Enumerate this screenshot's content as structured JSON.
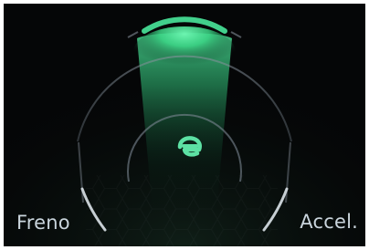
{
  "gauge": {
    "mode_icon": "eco-e-icon",
    "level": 0.18,
    "labels": {
      "left": "Freno",
      "right": "Accel."
    }
  },
  "colors": {
    "background": "#050607",
    "glow": "#38d68b",
    "ring": "#7d8792",
    "text": "#c9d4dc"
  }
}
